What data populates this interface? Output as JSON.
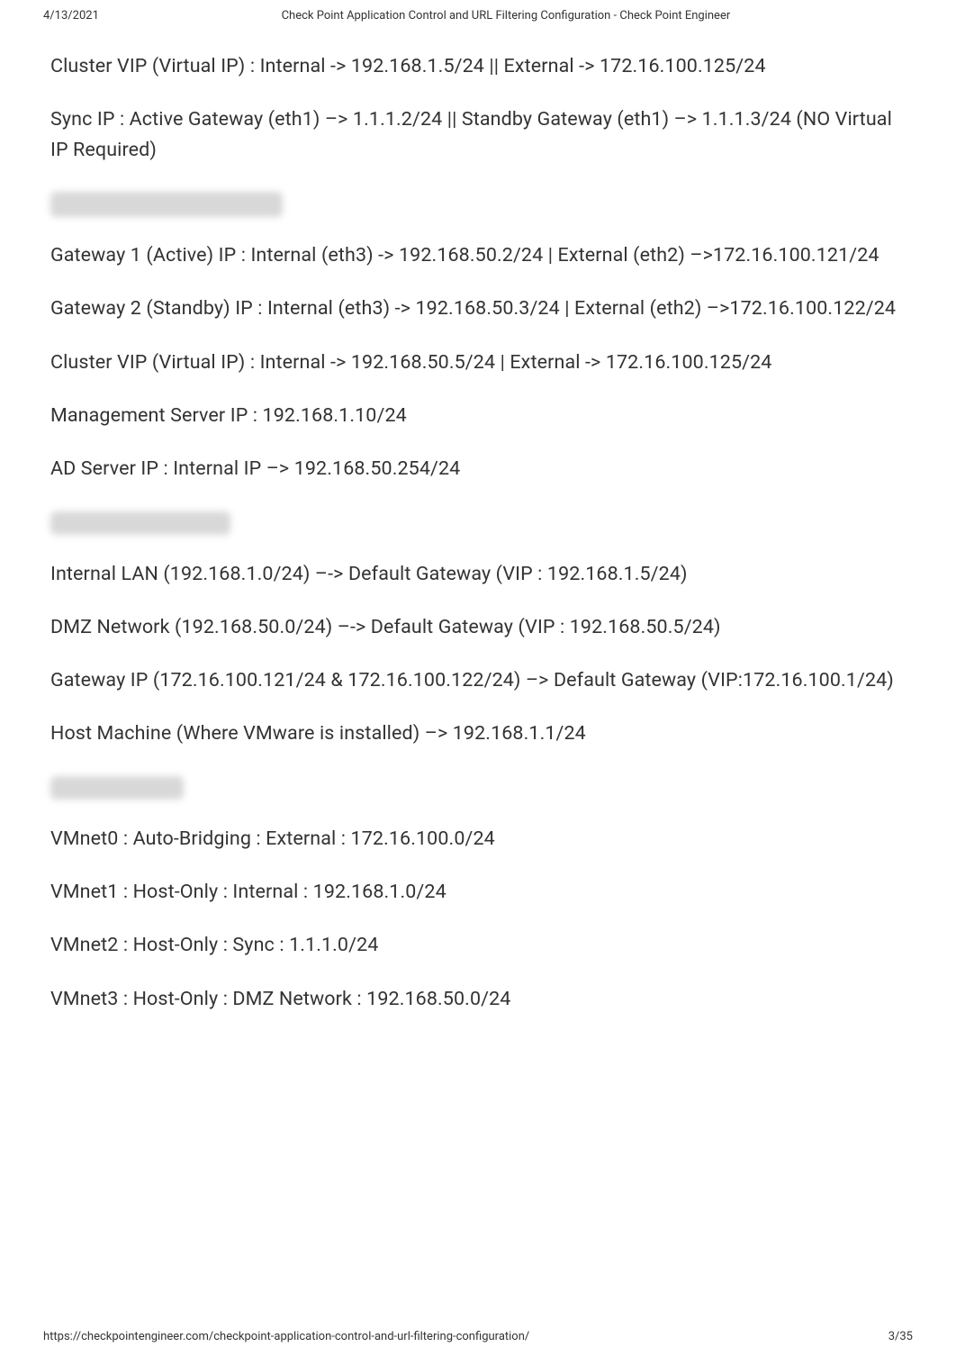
{
  "header": {
    "date": "4/13/2021",
    "title": "Check Point Application Control and URL Filtering Configuration - Check Point Engineer"
  },
  "paragraphs": {
    "p1": "Cluster VIP (Virtual IP) : Internal -> 192.168.1.5/24 || External -> 172.16.100.125/24",
    "p2": "Sync IP : Active Gateway (eth1) –> 1.1.1.2/24  || Standby Gateway (eth1) –> 1.1.1.3/24  (NO Virtual IP Required)",
    "p3": "Gateway 1 (Active) IP : Internal (eth3)  -> 192.168.50.2/24 | External (eth2) –>172.16.100.121/24",
    "p4": "Gateway 2 (Standby) IP : Internal (eth3) -> 192.168.50.3/24 | External (eth2) –>172.16.100.122/24",
    "p5": "Cluster VIP (Virtual IP) : Internal -> 192.168.50.5/24 | External -> 172.16.100.125/24",
    "p6": "Management Server IP : 192.168.1.10/24",
    "p7": "AD Server IP : Internal IP –> 192.168.50.254/24",
    "p8": "Internal LAN (192.168.1.0/24) –->  Default Gateway (VIP : 192.168.1.5/24)",
    "p9": "DMZ Network (192.168.50.0/24) –->  Default Gateway (VIP : 192.168.50.5/24)",
    "p10": "Gateway IP (172.16.100.121/24  & 172.16.100.122/24) –> Default Gateway (VIP:172.16.100.1/24)",
    "p11": "Host Machine (Where VMware is installed) –> 192.168.1.1/24",
    "p12": "VMnet0 : Auto-Bridging  : External : 172.16.100.0/24",
    "p13": "VMnet1 : Host-Only : Internal  : 192.168.1.0/24",
    "p14": "VMnet2 : Host-Only : Sync : 1.1.1.0/24",
    "p15": "VMnet3 : Host-Only : DMZ Network : 192.168.50.0/24"
  },
  "blurred": {
    "h1": "DMZ Network(AD Server)",
    "h2": "Route Configuration",
    "h3": "VMNet Details"
  },
  "footer": {
    "url": "https://checkpointengineer.com/checkpoint-application-control-and-url-filtering-configuration/",
    "page": "3/35"
  }
}
